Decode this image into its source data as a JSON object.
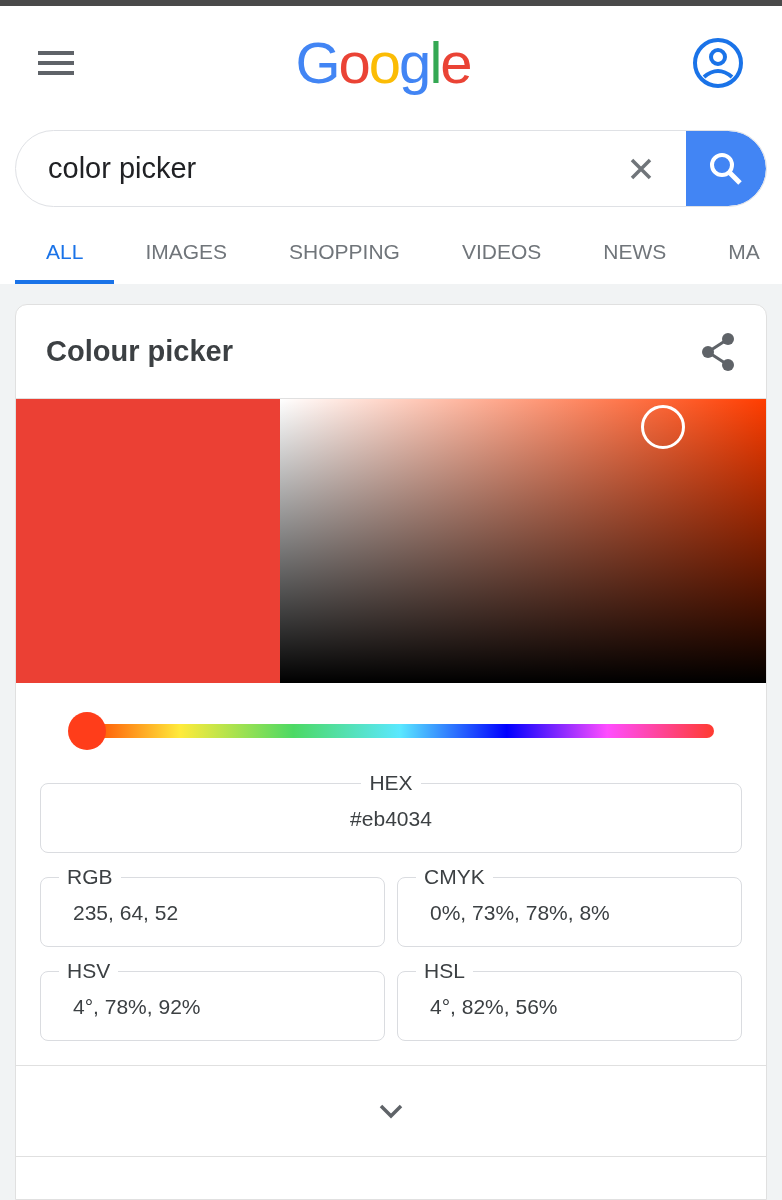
{
  "header": {
    "logo": "Google"
  },
  "search": {
    "value": "color picker"
  },
  "tabs": [
    {
      "label": "ALL",
      "selected": true
    },
    {
      "label": "IMAGES",
      "selected": false
    },
    {
      "label": "SHOPPING",
      "selected": false
    },
    {
      "label": "VIDEOS",
      "selected": false
    },
    {
      "label": "NEWS",
      "selected": false
    },
    {
      "label": "MA",
      "selected": false
    }
  ],
  "card": {
    "title": "Colour picker",
    "hue": {
      "level": 0
    },
    "hex": {
      "label": "HEX",
      "value": "#eb4034"
    },
    "fields": [
      {
        "label": "RGB",
        "value": "235, 64, 52"
      },
      {
        "label": "CMYK",
        "value": "0%, 73%, 78%, 8%"
      },
      {
        "label": "HSV",
        "value": "4°, 78%, 92%"
      },
      {
        "label": "HSL",
        "value": "4°, 82%, 56%"
      }
    ]
  }
}
